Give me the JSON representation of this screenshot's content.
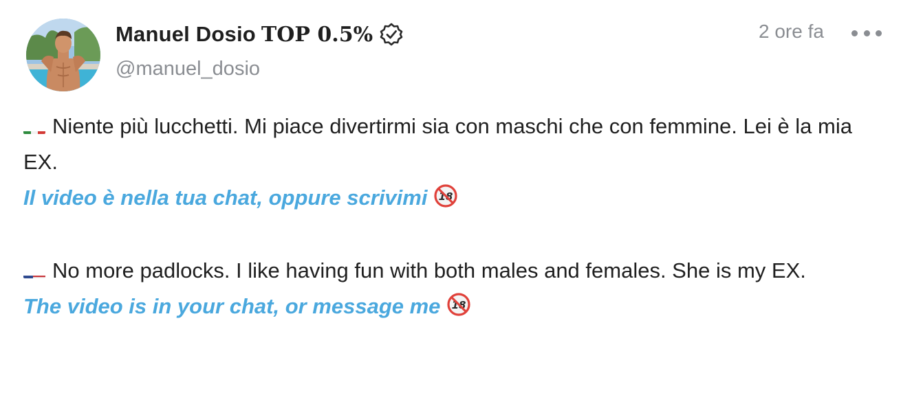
{
  "author": {
    "name": "Manuel Dosio",
    "badge": "TOP 0.5%",
    "handle": "@manuel_dosio",
    "verified_icon": "verified-badge-icon",
    "avatar_icon": "avatar-photo"
  },
  "meta": {
    "time": "2 ore fa",
    "more_icon": "more-options-icon"
  },
  "post": {
    "italian": {
      "flag_icon": "italy-flag-icon",
      "text": "Niente più lucchetti. Mi piace divertirmi sia con maschi che con femmine. Lei è la mia EX.",
      "cta": "Il video è nella tua chat, oppure scrivimi",
      "cta_icon": "no-under-18-icon"
    },
    "english": {
      "flag_icon": "usa-flag-icon",
      "text": "No more padlocks. I like having fun with both males and females. She is my EX.",
      "cta": "The video is in your chat, or message me",
      "cta_icon": "no-under-18-icon"
    }
  },
  "colors": {
    "text": "#1f1f1f",
    "muted": "#8a8d92",
    "link": "#4aa8de",
    "background": "#ffffff"
  }
}
